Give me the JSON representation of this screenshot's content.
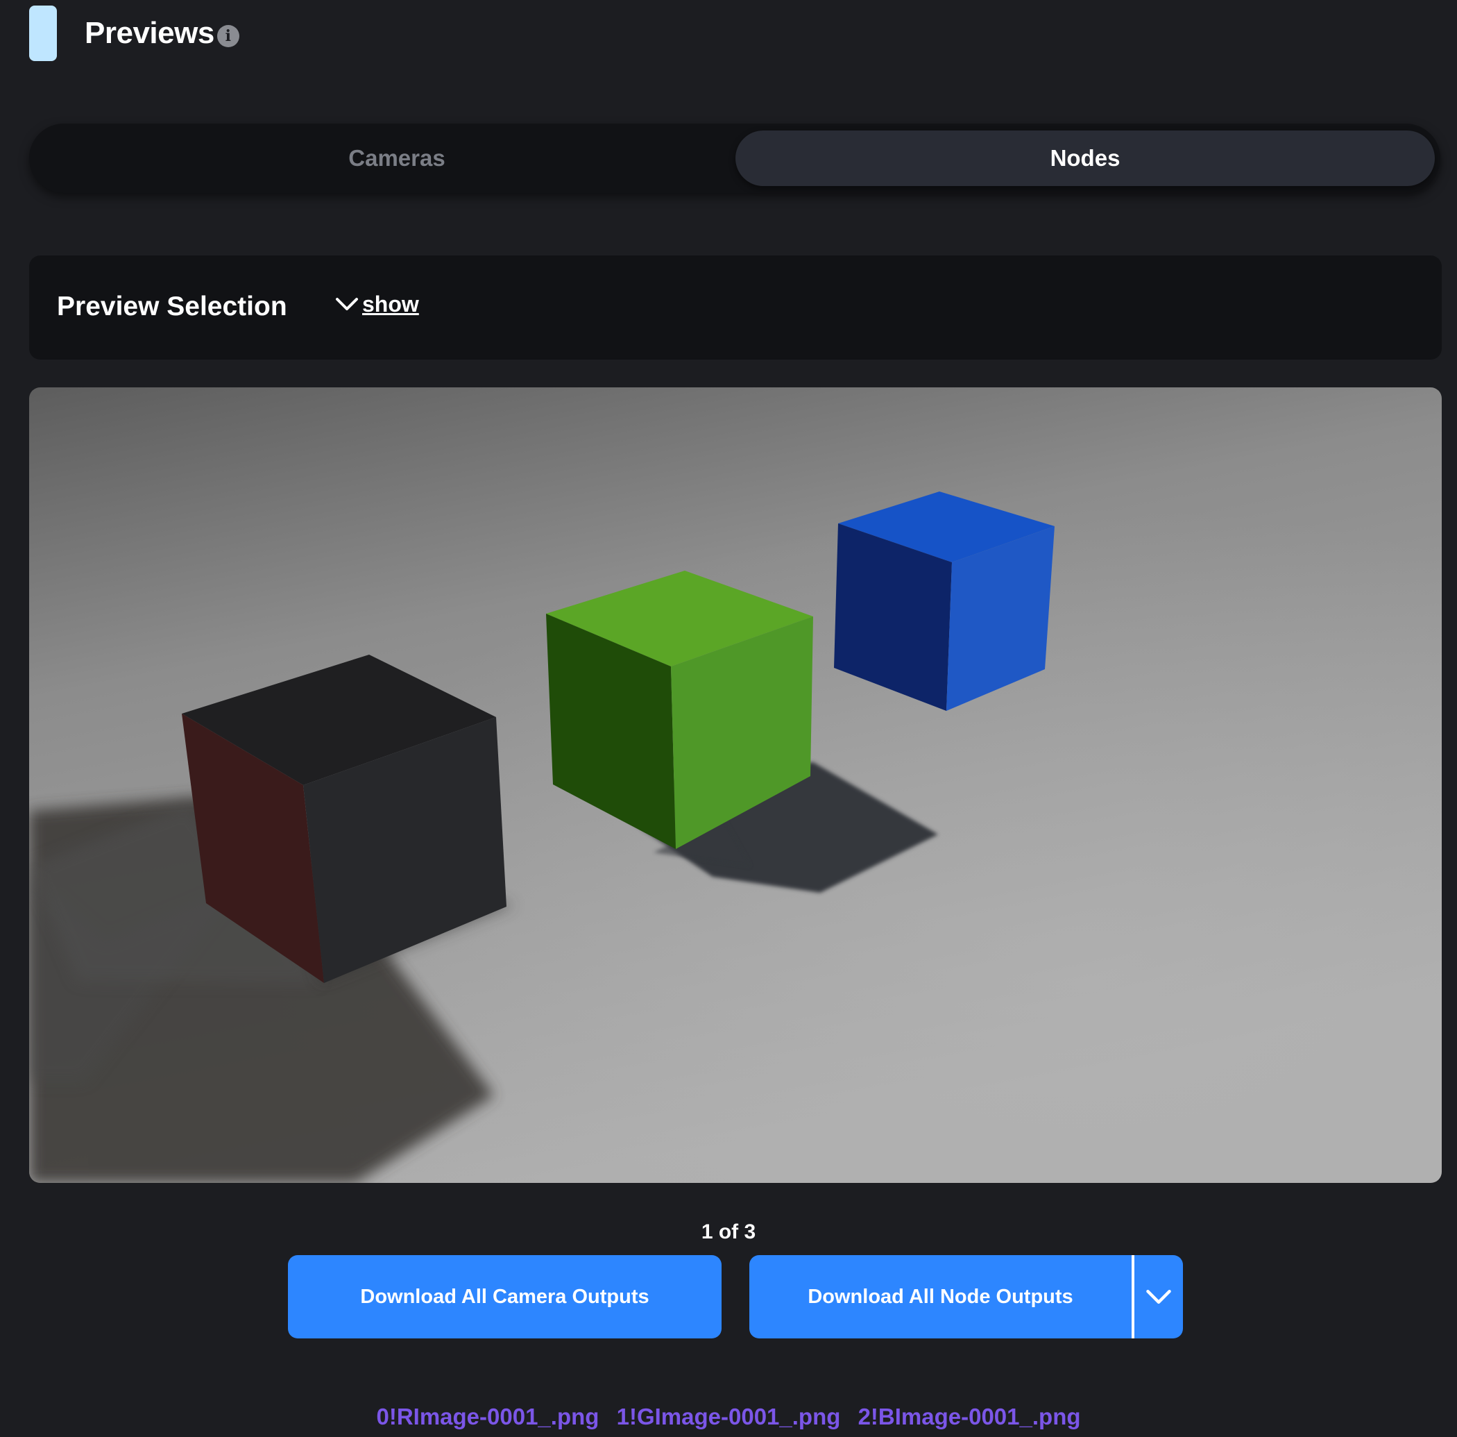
{
  "header": {
    "title": "Previews",
    "info_icon": "info-icon",
    "accent_color": "#bfe6ff"
  },
  "tabs": [
    {
      "label": "Cameras",
      "active": false
    },
    {
      "label": "Nodes",
      "active": true
    }
  ],
  "preview_selection": {
    "title": "Preview Selection",
    "toggle_label": "show",
    "toggle_icon": "chevron-down-icon"
  },
  "preview": {
    "page": "1 of 3"
  },
  "actions": {
    "camera_button": "Download All Camera Outputs",
    "node_button": "Download All Node Outputs",
    "node_dropdown_icon": "chevron-down-icon",
    "button_color": "#2d86ff"
  },
  "files": [
    "0!RImage-0001_.png",
    "1!GImage-0001_.png",
    "2!BImage-0001_.png"
  ],
  "colors": {
    "background": "#1c1d21",
    "panel": "#111215",
    "link": "#7b56e8"
  }
}
